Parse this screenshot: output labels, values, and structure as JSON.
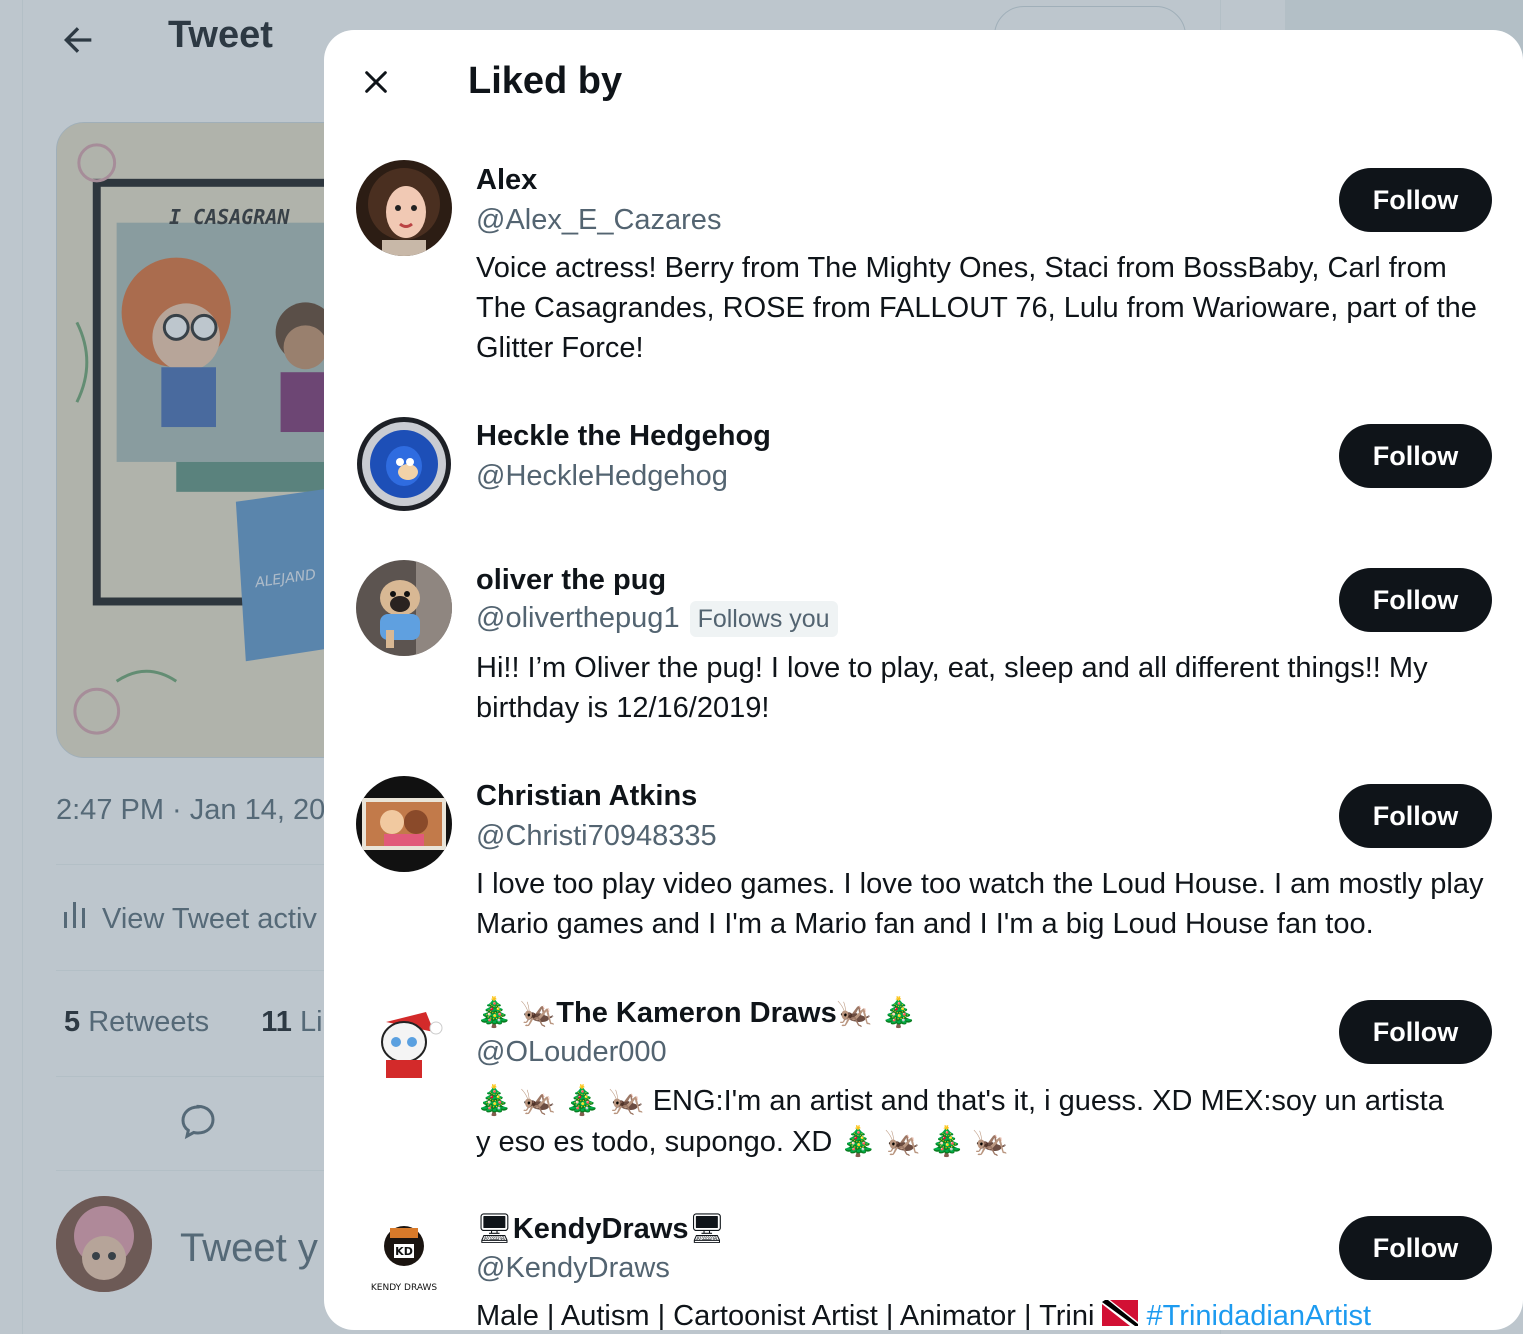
{
  "background": {
    "header_title": "Tweet",
    "timestamp": "2:47 PM · Jan 14, 20",
    "activity_label": "View Tweet activ",
    "retweets_count": "5",
    "retweets_label": "Retweets",
    "likes_count": "11",
    "likes_label": "Lik",
    "compose_placeholder": "Tweet y",
    "image_caption": "I CASAGRAN",
    "banner_text": "ALEJAND"
  },
  "modal": {
    "title": "Liked by",
    "follow_label": "Follow",
    "users": [
      {
        "name": "Alex",
        "handle": "@Alex_E_Cazares",
        "bio": "Voice actress! Berry from The Mighty Ones, Staci from BossBaby, Carl from The Casagrandes, ROSE from FALLOUT 76, Lulu from Warioware, part of the Glitter Force!"
      },
      {
        "name": "Heckle the Hedgehog",
        "handle": "@HeckleHedgehog",
        "bio": ""
      },
      {
        "name": "oliver the pug",
        "handle": "@oliverthepug1",
        "badge": "Follows you",
        "bio": "Hi!! I’m Oliver the pug! I love to play, eat, sleep and all different things!! My birthday is 12/16/2019!"
      },
      {
        "name": "Christian Atkins",
        "handle": "@Christi70948335",
        "bio": "I love too play video games. I love too watch the Loud House. I am mostly play Mario games and I I'm a Mario fan and I I'm a big Loud House fan too."
      },
      {
        "name": "The Kameron Draws",
        "handle": "@OLouder000",
        "bio_line1": "ENG:I'm an artist and that's it, i guess. XD MEX:soy un artista",
        "bio_line2": "y eso es todo, supongo. XD"
      },
      {
        "name": "KendyDraws",
        "handle": "@KendyDraws",
        "bio": "Male | Autism | Cartoonist Artist | Animator | Trini",
        "hashtag": "#TrinidadianArtist",
        "avatar_text": "KD",
        "avatar_subtext": "KENDY DRAWS"
      }
    ]
  },
  "colors": {
    "text_primary": "#0f1419",
    "text_secondary": "#536471",
    "link": "#1d9bf0",
    "button_bg": "#0f1419",
    "overlay": "rgba(91,112,131,0.4)"
  }
}
